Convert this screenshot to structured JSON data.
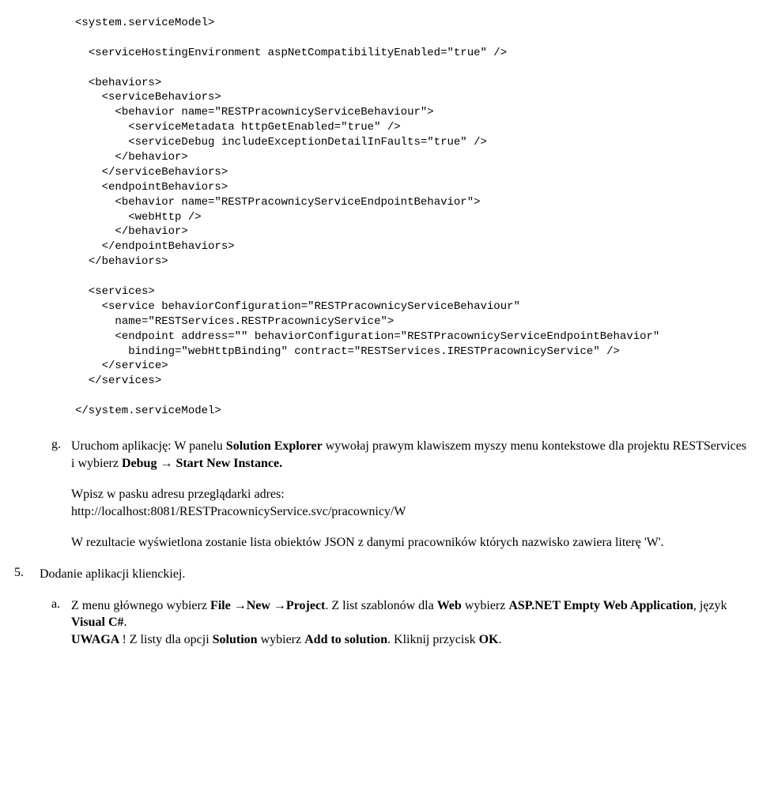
{
  "code": {
    "l1": "<system.serviceModel>",
    "l2": "<serviceHostingEnvironment aspNetCompatibilityEnabled=\"true\" />",
    "l3": "<behaviors>",
    "l4": "<serviceBehaviors>",
    "l5": "<behavior name=\"RESTPracownicyServiceBehaviour\">",
    "l6": "<serviceMetadata httpGetEnabled=\"true\" />",
    "l7": "<serviceDebug includeExceptionDetailInFaults=\"true\" />",
    "l8": "</behavior>",
    "l9": "</serviceBehaviors>",
    "l10": "<endpointBehaviors>",
    "l11": "<behavior name=\"RESTPracownicyServiceEndpointBehavior\">",
    "l12": "<webHttp />",
    "l13": "</behavior>",
    "l14": "</endpointBehaviors>",
    "l15": "</behaviors>",
    "l16": "<services>",
    "l17": "<service behaviorConfiguration=\"RESTPracownicyServiceBehaviour\"",
    "l18": "name=\"RESTServices.RESTPracownicyService\">",
    "l19": "<endpoint address=\"\" behaviorConfiguration=\"RESTPracownicyServiceEndpointBehavior\"",
    "l20": "binding=\"webHttpBinding\" contract=\"RESTServices.IRESTPracownicyService\" />",
    "l21": "</service>",
    "l22": "</services>",
    "l23": "</system.serviceModel>"
  },
  "g": {
    "marker": "g.",
    "p1_a": "Uruchom aplikację: W panelu ",
    "p1_b": "Solution Explorer",
    "p1_c": " wywołaj prawym klawiszem myszy menu kontekstowe dla projektu RESTServices i wybierz ",
    "p1_d": "Debug → Start New Instance.",
    "p2_a": "Wpisz w pasku adresu przeglądarki adres:",
    "p2_b": "http://localhost:8081/RESTPracownicyService.svc/pracownicy/W",
    "p3": "W rezultacie wyświetlona zostanie lista obiektów JSON z danymi pracowników których nazwisko zawiera literę 'W'."
  },
  "five": {
    "marker": "5.",
    "title": "Dodanie aplikacji klienckiej.",
    "a": {
      "marker": "a.",
      "p1_a": "Z menu głównego wybierz ",
      "p1_b": "File →New →Project",
      "p1_c": ". Z list szablonów dla ",
      "p1_d": "Web",
      "p1_e": " wybierz ",
      "p1_f": "ASP.NET Empty Web Application",
      "p1_g": ", język ",
      "p1_h": "Visual C#",
      "p1_i": ".",
      "p2_a": "UWAGA ",
      "p2_b": "! Z listy dla opcji ",
      "p2_c": "Solution",
      "p2_d": " wybierz ",
      "p2_e": "Add to solution",
      "p2_f": ". Kliknij przycisk ",
      "p2_g": "OK",
      "p2_h": "."
    }
  }
}
